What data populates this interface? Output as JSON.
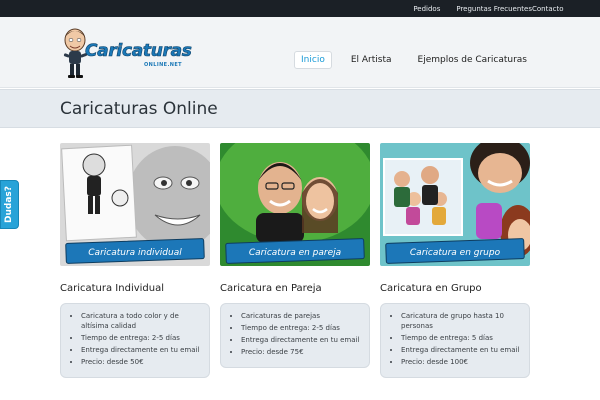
{
  "topnav": {
    "links": [
      "Pedidos",
      "Preguntas Frecuentes",
      "Contacto"
    ]
  },
  "brand": {
    "logo_text": "Caricaturas",
    "logo_subtext": "ONLINE.NET"
  },
  "mainnav": {
    "items": [
      "Inicio",
      "El Artista",
      "Ejemplos de Caricaturas"
    ],
    "active": "Inicio"
  },
  "page": {
    "title": "Caricaturas Online"
  },
  "sidetab": {
    "label": "Dudas?"
  },
  "cards": [
    {
      "banner": "Caricatura individual",
      "title": "Caricatura Individual",
      "features": [
        "Caricatura a todo color y de altísima calidad",
        "Tiempo de entrega: 2-5 días",
        "Entrega directamente en tu email",
        "Precio: desde 50€"
      ]
    },
    {
      "banner": "Caricatura en pareja",
      "title": "Caricatura en Pareja",
      "features": [
        "Caricaturas de parejas",
        "Tiempo de entrega: 2-5 días",
        "Entrega directamente en tu email",
        "Precio: desde 75€"
      ]
    },
    {
      "banner": "Caricatura en grupo",
      "title": "Caricatura en Grupo",
      "features": [
        "Caricatura de grupo hasta 10 personas",
        "Tiempo de entrega: 5 días",
        "Entrega directamente en tu email",
        "Precio: desde 100€"
      ]
    }
  ]
}
